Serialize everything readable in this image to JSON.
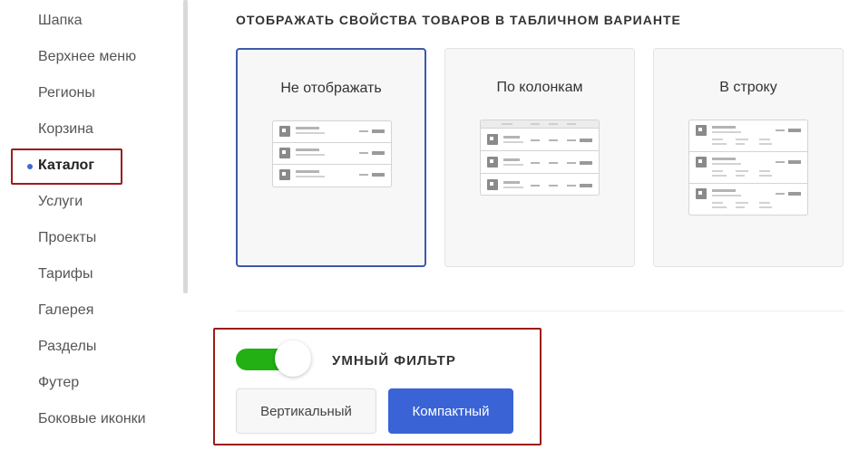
{
  "sidebar": {
    "items": [
      {
        "label": "Шапка"
      },
      {
        "label": "Верхнее меню"
      },
      {
        "label": "Регионы"
      },
      {
        "label": "Корзина"
      },
      {
        "label": "Каталог"
      },
      {
        "label": "Услуги"
      },
      {
        "label": "Проекты"
      },
      {
        "label": "Тарифы"
      },
      {
        "label": "Галерея"
      },
      {
        "label": "Разделы"
      },
      {
        "label": "Футер"
      },
      {
        "label": "Боковые иконки"
      }
    ],
    "active_item": "Каталог"
  },
  "properties_section": {
    "title": "ОТОБРАЖАТЬ СВОЙСТВА ТОВАРОВ В ТАБЛИЧНОМ ВАРИАНТЕ",
    "options": [
      {
        "label": "Не отображать",
        "selected": true,
        "icon": "table-no-props-icon"
      },
      {
        "label": "По колонкам",
        "selected": false,
        "icon": "table-columns-icon"
      },
      {
        "label": "В строку",
        "selected": false,
        "icon": "table-row-icon"
      }
    ]
  },
  "smart_filter": {
    "title": "УМНЫЙ ФИЛЬТР",
    "enabled": true,
    "buttons": {
      "vertical": "Вертикальный",
      "compact": "Компактный"
    },
    "selected": "Компактный"
  },
  "colors": {
    "accent_blue": "#3a63d6",
    "selected_border": "#3d5aa9",
    "toggle_on": "#22b014",
    "highlight_red": "#9b1c1c"
  }
}
